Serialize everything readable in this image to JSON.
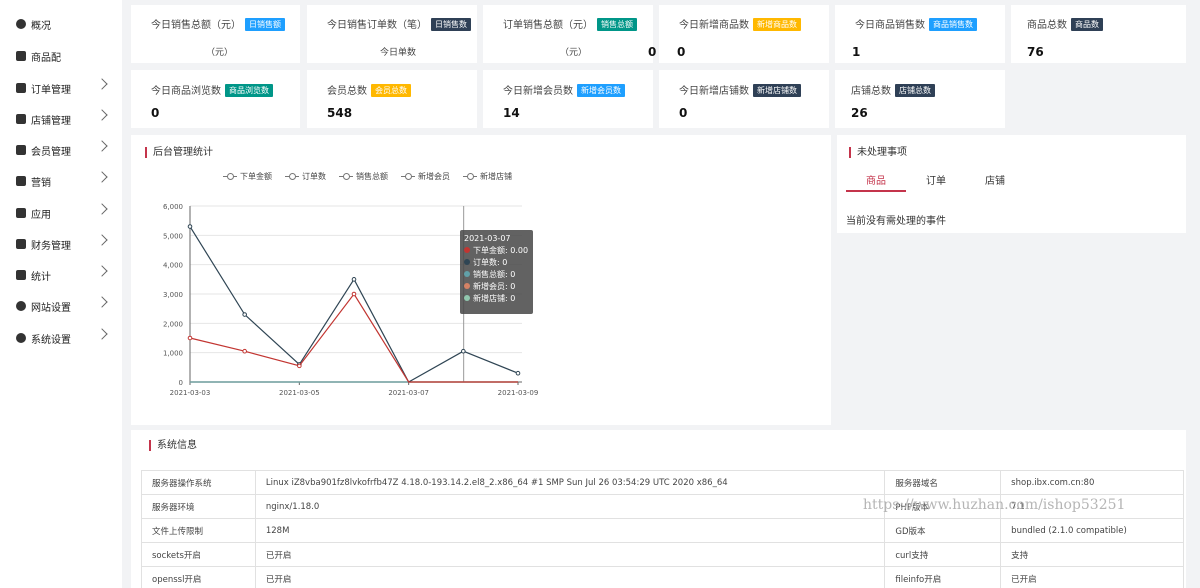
{
  "sidebar": {
    "items": [
      {
        "label": "概况",
        "icon": "pie-chart-icon",
        "chevron": false
      },
      {
        "label": "商品配",
        "icon": "box-icon",
        "chevron": false
      },
      {
        "label": "订单管理",
        "icon": "order-icon",
        "chevron": true
      },
      {
        "label": "店铺管理",
        "icon": "store-icon",
        "chevron": true
      },
      {
        "label": "会员管理",
        "icon": "members-icon",
        "chevron": true
      },
      {
        "label": "营销",
        "icon": "marketing-icon",
        "chevron": true
      },
      {
        "label": "应用",
        "icon": "apps-icon",
        "chevron": true
      },
      {
        "label": "财务管理",
        "icon": "finance-icon",
        "chevron": true
      },
      {
        "label": "统计",
        "icon": "stats-icon",
        "chevron": true
      },
      {
        "label": "网站设置",
        "icon": "globe-icon",
        "chevron": true
      },
      {
        "label": "系统设置",
        "icon": "gear-icon",
        "chevron": true
      }
    ]
  },
  "stats": {
    "row1": [
      {
        "title": "今日销售总额（元）",
        "badge": "日销售额",
        "badge_color": "#1e9fff",
        "sub": "（元）"
      },
      {
        "title": "今日销售订单数（笔）",
        "badge": "日销售数",
        "badge_color": "#2f4056",
        "sub": "今日单数"
      },
      {
        "title": "订单销售总额（元）",
        "badge": "销售总额",
        "badge_color": "#009688",
        "sub": "（元）",
        "value": "0"
      },
      {
        "title": "今日新增商品数",
        "badge": "新增商品数",
        "badge_color": "#ffb800",
        "value": "0"
      },
      {
        "title": "今日商品销售数",
        "badge": "商品销售数",
        "badge_color": "#1e9fff",
        "value": "1"
      },
      {
        "title": "商品总数",
        "badge": "商品数",
        "badge_color": "#2f4056",
        "value": "76"
      }
    ],
    "row2": [
      {
        "title": "今日商品浏览数",
        "badge": "商品浏览数",
        "badge_color": "#009688",
        "value": "0"
      },
      {
        "title": "会员总数",
        "badge": "会员总数",
        "badge_color": "#ffb800",
        "value": "548"
      },
      {
        "title": "今日新增会员数",
        "badge": "新增会员数",
        "badge_color": "#1e9fff",
        "value": "14"
      },
      {
        "title": "今日新增店铺数",
        "badge": "新增店铺数",
        "badge_color": "#2f4056",
        "value": "0"
      },
      {
        "title": "店铺总数",
        "badge": "店铺总数",
        "badge_color": "#2f4056",
        "value": "26"
      }
    ]
  },
  "chart_panel": {
    "title": "后台管理统计"
  },
  "chart_data": {
    "type": "line",
    "x": [
      "2021-03-03",
      "2021-03-04",
      "2021-03-05",
      "2021-03-06",
      "2021-03-07",
      "2021-03-08",
      "2021-03-09"
    ],
    "x_tick_labels": [
      "2021-03-03",
      "2021-03-05",
      "2021-03-07",
      "2021-03-09"
    ],
    "ylim": [
      0,
      6000
    ],
    "y_ticks": [
      0,
      1000,
      2000,
      3000,
      4000,
      5000,
      6000
    ],
    "y_tick_labels": [
      "0",
      "1,000",
      "2,000",
      "3,000",
      "4,000",
      "5,000",
      "6,000"
    ],
    "grid": true,
    "legend_position": "top",
    "series": [
      {
        "name": "下单金额",
        "color": "#c23531",
        "values": [
          1500,
          1050,
          550,
          3000,
          0,
          0,
          0
        ]
      },
      {
        "name": "订单数",
        "color": "#2f4554",
        "values": [
          5300,
          2300,
          600,
          3500,
          0,
          1050,
          300
        ]
      },
      {
        "name": "销售总额",
        "color": "#61a0a8",
        "values": [
          0,
          0,
          0,
          0,
          0,
          0,
          0
        ]
      },
      {
        "name": "新增会员",
        "color": "#d48265",
        "values": [
          0,
          0,
          0,
          0,
          0,
          0,
          0
        ]
      },
      {
        "name": "新增店铺",
        "color": "#91c7ae",
        "values": [
          0,
          0,
          0,
          0,
          0,
          0,
          0
        ]
      }
    ],
    "tooltip": {
      "date": "2021-03-07",
      "rows": [
        {
          "name": "下单金额",
          "value": "0.00"
        },
        {
          "name": "订单数",
          "value": "0"
        },
        {
          "name": "销售总额",
          "value": "0"
        },
        {
          "name": "新增会员",
          "value": "0"
        },
        {
          "name": "新增店铺",
          "value": "0"
        }
      ]
    }
  },
  "todo": {
    "title": "未处理事项",
    "tabs": [
      "商品",
      "订单",
      "店铺"
    ],
    "active_tab": 0,
    "empty_text": "当前没有需处理的事件"
  },
  "system": {
    "title": "系统信息",
    "rows": [
      [
        "服务器操作系统",
        "Linux iZ8vba901fz8lvkofrfb47Z 4.18.0-193.14.2.el8_2.x86_64 #1 SMP Sun Jul 26 03:54:29 UTC 2020 x86_64",
        "服务器域名",
        "shop.ibx.com.cn:80"
      ],
      [
        "服务器环境",
        "nginx/1.18.0",
        "PHP版本",
        "7.1"
      ],
      [
        "文件上传限制",
        "128M",
        "GD版本",
        "bundled (2.1.0 compatible)"
      ],
      [
        "sockets开启",
        "已开启",
        "curl支持",
        "支持"
      ],
      [
        "openssl开启",
        "已开启",
        "fileinfo开启",
        "已开启"
      ]
    ]
  },
  "watermark": {
    "text": "https://www.huzhan.com/ishop53251"
  }
}
